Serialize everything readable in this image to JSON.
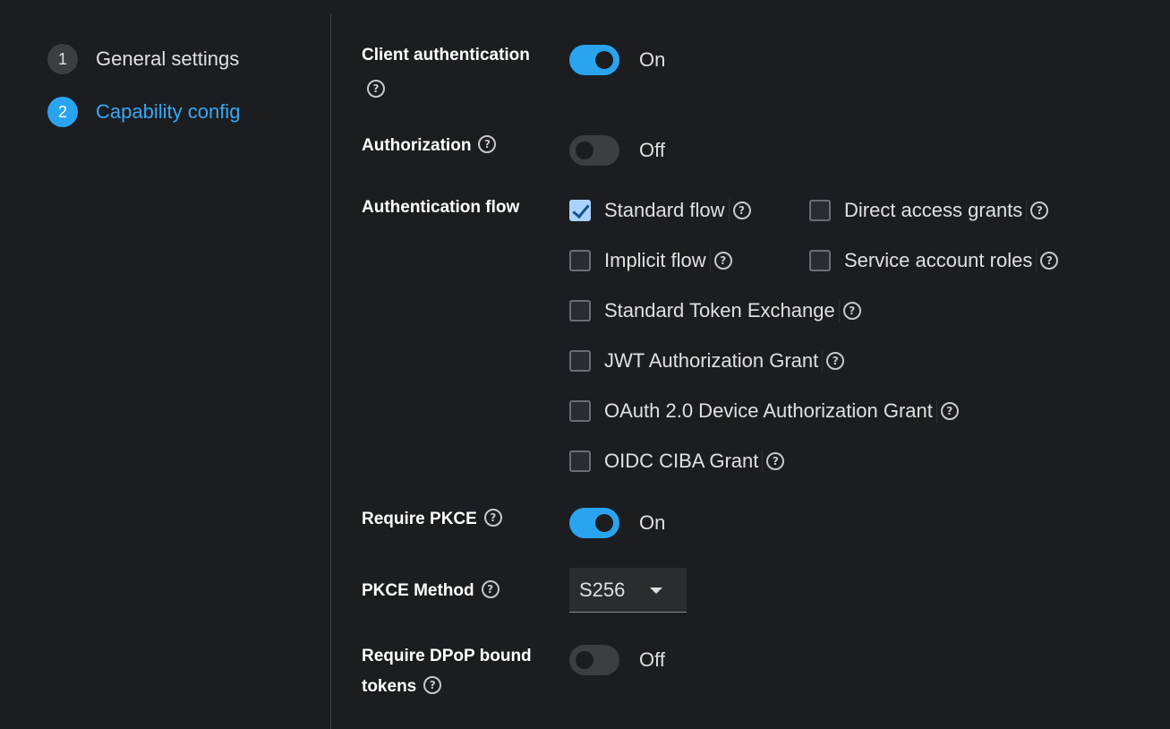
{
  "steps": [
    {
      "number": "1",
      "label": "General settings",
      "active": false
    },
    {
      "number": "2",
      "label": "Capability config",
      "active": true
    }
  ],
  "form": {
    "client_authentication": {
      "label": "Client authentication",
      "state": "On"
    },
    "authorization": {
      "label": "Authorization",
      "state": "Off"
    },
    "authentication_flow": {
      "label": "Authentication flow",
      "options": {
        "standard_flow": {
          "label": "Standard flow",
          "checked": true
        },
        "direct_access_grants": {
          "label": "Direct access grants",
          "checked": false
        },
        "implicit_flow": {
          "label": "Implicit flow",
          "checked": false
        },
        "service_account_roles": {
          "label": "Service account roles",
          "checked": false
        },
        "standard_token_exchange": {
          "label": "Standard Token Exchange",
          "checked": false
        },
        "jwt_authorization_grant": {
          "label": "JWT Authorization Grant",
          "checked": false
        },
        "oauth_device_grant": {
          "label": "OAuth 2.0 Device Authorization Grant",
          "checked": false
        },
        "oidc_ciba_grant": {
          "label": "OIDC CIBA Grant",
          "checked": false
        }
      }
    },
    "require_pkce": {
      "label": "Require PKCE",
      "state": "On"
    },
    "pkce_method": {
      "label": "PKCE Method",
      "value": "S256"
    },
    "require_dpop": {
      "label_line1": "Require DPoP bound",
      "label_line2": "tokens",
      "state": "Off"
    }
  },
  "icons": {
    "help": "?"
  },
  "colors": {
    "accent": "#2ba4f0",
    "background": "#1b1d21",
    "checkbox_checked": "#a9d3ff"
  }
}
